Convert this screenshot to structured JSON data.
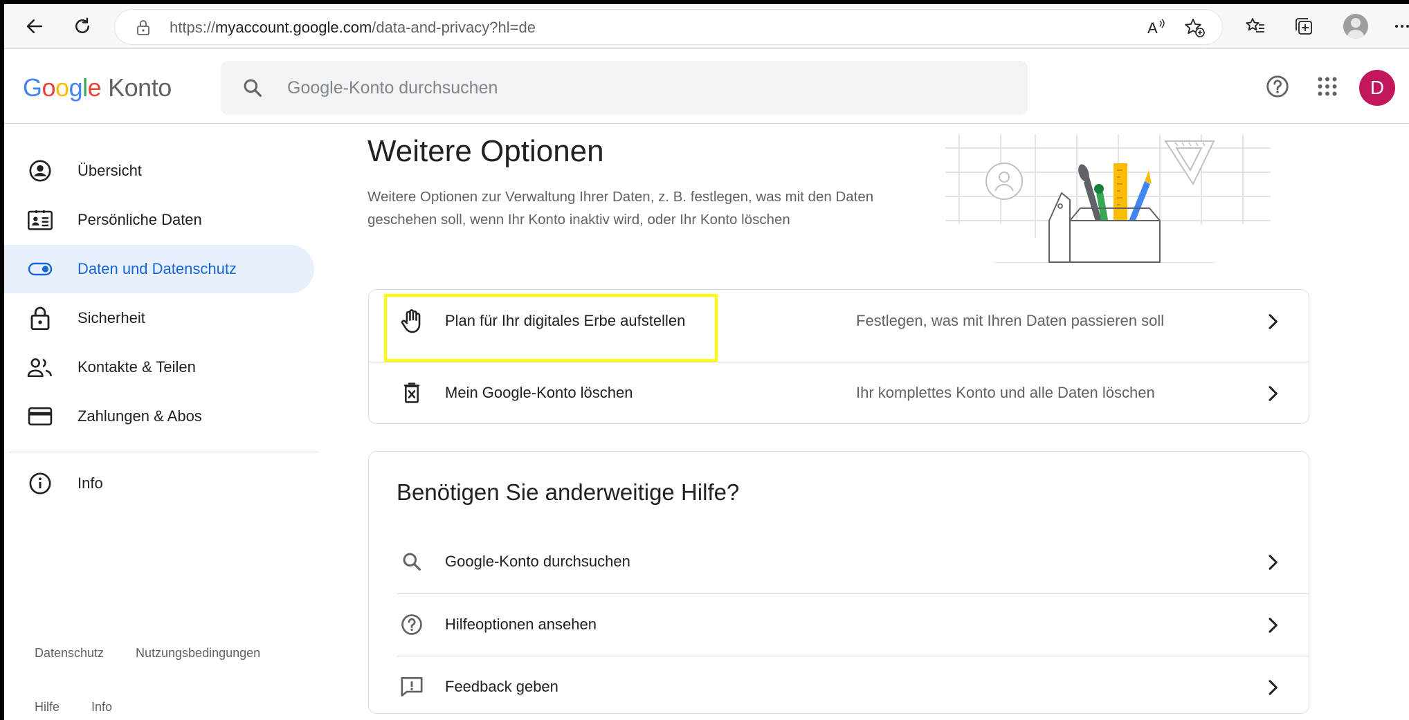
{
  "browser": {
    "url_prefix": "https://",
    "url_domain": "myaccount.google.com",
    "url_path": "/data-and-privacy?hl=de"
  },
  "header": {
    "logo_letters": [
      "G",
      "o",
      "o",
      "g",
      "l",
      "e"
    ],
    "product": "Konto",
    "search_placeholder": "Google-Konto durchsuchen",
    "avatar_initial": "D"
  },
  "sidebar": {
    "items": [
      {
        "label": "Übersicht",
        "icon": "account-circle-icon"
      },
      {
        "label": "Persönliche Daten",
        "icon": "id-card-icon"
      },
      {
        "label": "Daten und Datenschutz",
        "icon": "toggle-icon",
        "active": true
      },
      {
        "label": "Sicherheit",
        "icon": "lock-icon"
      },
      {
        "label": "Kontakte & Teilen",
        "icon": "people-icon"
      },
      {
        "label": "Zahlungen & Abos",
        "icon": "credit-card-icon"
      }
    ],
    "info_label": "Info",
    "footer": {
      "privacy": "Datenschutz",
      "terms": "Nutzungsbedingungen",
      "help": "Hilfe",
      "info": "Info"
    }
  },
  "main": {
    "title": "Weitere Optionen",
    "description": "Weitere Optionen zur Verwaltung Ihrer Daten, z. B. festlegen, was mit den Daten geschehen soll, wenn Ihr Konto inaktiv wird, oder Ihr Konto löschen",
    "options": [
      {
        "title": "Plan für Ihr digitales Erbe aufstellen",
        "desc": "Festlegen, was mit Ihren Daten passieren soll",
        "icon": "hand-icon"
      },
      {
        "title": "Mein Google-Konto löschen",
        "desc": "Ihr komplettes Konto und alle Daten löschen",
        "icon": "delete-box-icon"
      }
    ],
    "help": {
      "title": "Benötigen Sie anderweitige Hilfe?",
      "items": [
        {
          "label": "Google-Konto durchsuchen",
          "icon": "search-icon"
        },
        {
          "label": "Hilfeoptionen ansehen",
          "icon": "help-circle-icon"
        },
        {
          "label": "Feedback geben",
          "icon": "feedback-icon"
        }
      ]
    }
  },
  "colors": {
    "accent": "#1967d2",
    "active_bg": "#e8f0fe",
    "highlight": "#ffff00",
    "avatar": "#c2185b"
  }
}
